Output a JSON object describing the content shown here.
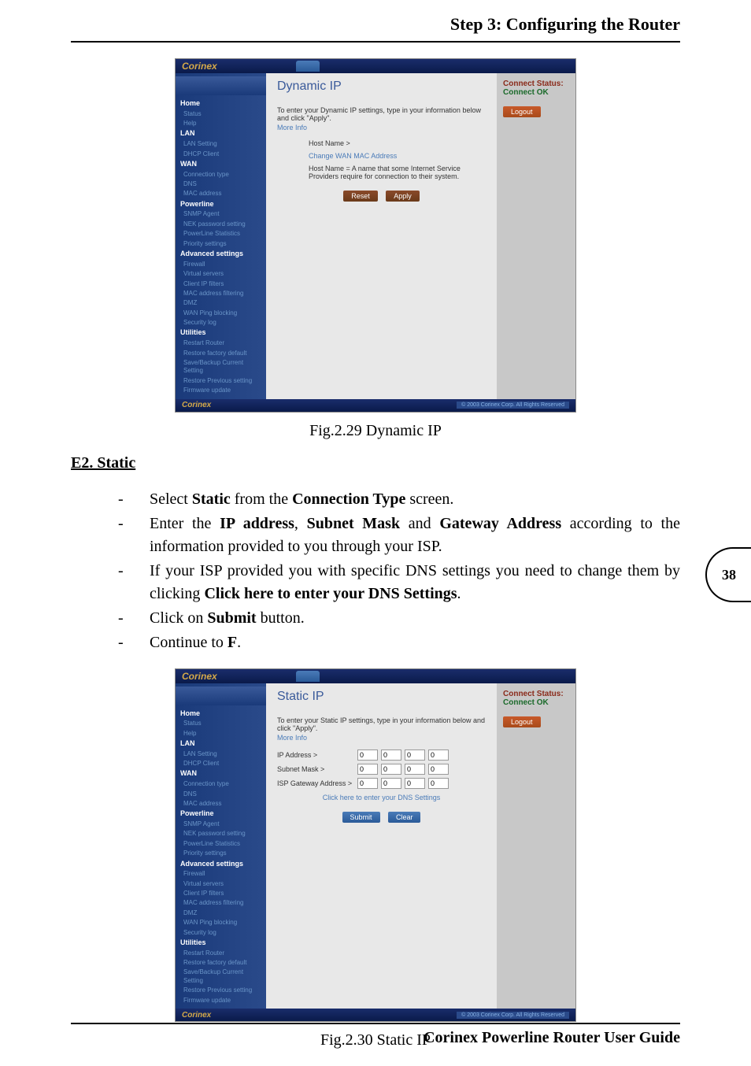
{
  "header": "Step 3: Configuring the Router",
  "footer": "Corinex Powerline Router User Guide",
  "pageNumber": "38",
  "captions": {
    "fig1": "Fig.2.29 Dynamic IP",
    "fig2": "Fig.2.30 Static IP"
  },
  "sectionHeading": "E2. Static",
  "bullets": [
    {
      "pre": "Select ",
      "b1": "Static",
      "mid1": " from the ",
      "b2": "Connection Type",
      "post": " screen."
    },
    {
      "pre": "Enter the ",
      "b1": "IP address",
      "mid1": ", ",
      "b2": "Subnet Mask",
      "mid2": " and ",
      "b3": "Gateway Address",
      "post": " according to the information provided to you through your ISP."
    },
    {
      "pre": "If your ISP provided you with specific DNS settings you need to change them by clicking ",
      "b1": "Click here to enter your DNS Settings",
      "post": "."
    },
    {
      "pre": "Click on ",
      "b1": "Submit",
      "post": " button."
    },
    {
      "pre": "Continue to ",
      "b1": "F",
      "post": "."
    }
  ],
  "screenshot": {
    "brand": "Corinex",
    "footerCopy": "© 2003 Corinex Corp. All Rights Reserved",
    "connectStatusLabel": "Connect Status:",
    "connectStatusValue": "Connect OK",
    "logout": "Logout",
    "nav": {
      "home": "Home",
      "status": "Status",
      "help": "Help",
      "lan": "LAN",
      "lanSetting": "LAN Setting",
      "dhcpClient": "DHCP Client",
      "wan": "WAN",
      "connType": "Connection type",
      "dns": "DNS",
      "macAddr": "MAC address",
      "powerline": "Powerline",
      "snmpAgent": "SNMP Agent",
      "nekPwd": "NEK password setting",
      "plStats": "PowerLine Statistics",
      "priority": "Priority settings",
      "advanced": "Advanced settings",
      "firewall": "Firewall",
      "virtSrv": "Virtual servers",
      "clientIp": "Client IP filters",
      "macFilter": "MAC address filtering",
      "dmz": "DMZ",
      "wanPing": "WAN Ping blocking",
      "secLog": "Security log",
      "utilities": "Utilities",
      "restart": "Restart Router",
      "restoreFactory": "Restore factory default",
      "saveBackup": "Save/Backup Current Setting",
      "restorePrev": "Restore Previous setting",
      "firmware": "Firmware update"
    },
    "dynamic": {
      "title": "Dynamic IP",
      "instr": "To enter your Dynamic IP settings, type in your information below and click \"Apply\".",
      "moreInfo": "More Info",
      "hostName": "Host Name >",
      "changeMac": "Change WAN MAC Address",
      "hostDesc": "Host Name = A name that some Internet Service Providers require for connection to their system.",
      "reset": "Reset",
      "apply": "Apply"
    },
    "staticIp": {
      "title": "Static IP",
      "instr": "To enter your Static IP settings, type in your information below and click \"Apply\".",
      "moreInfo": "More Info",
      "ipAddr": "IP Address >",
      "subnet": "Subnet Mask >",
      "gateway": "ISP Gateway Address >",
      "dnsLink": "Click here to enter your DNS Settings",
      "submit": "Submit",
      "clear": "Clear",
      "vals": [
        "0",
        "0",
        "0",
        "0"
      ]
    }
  }
}
